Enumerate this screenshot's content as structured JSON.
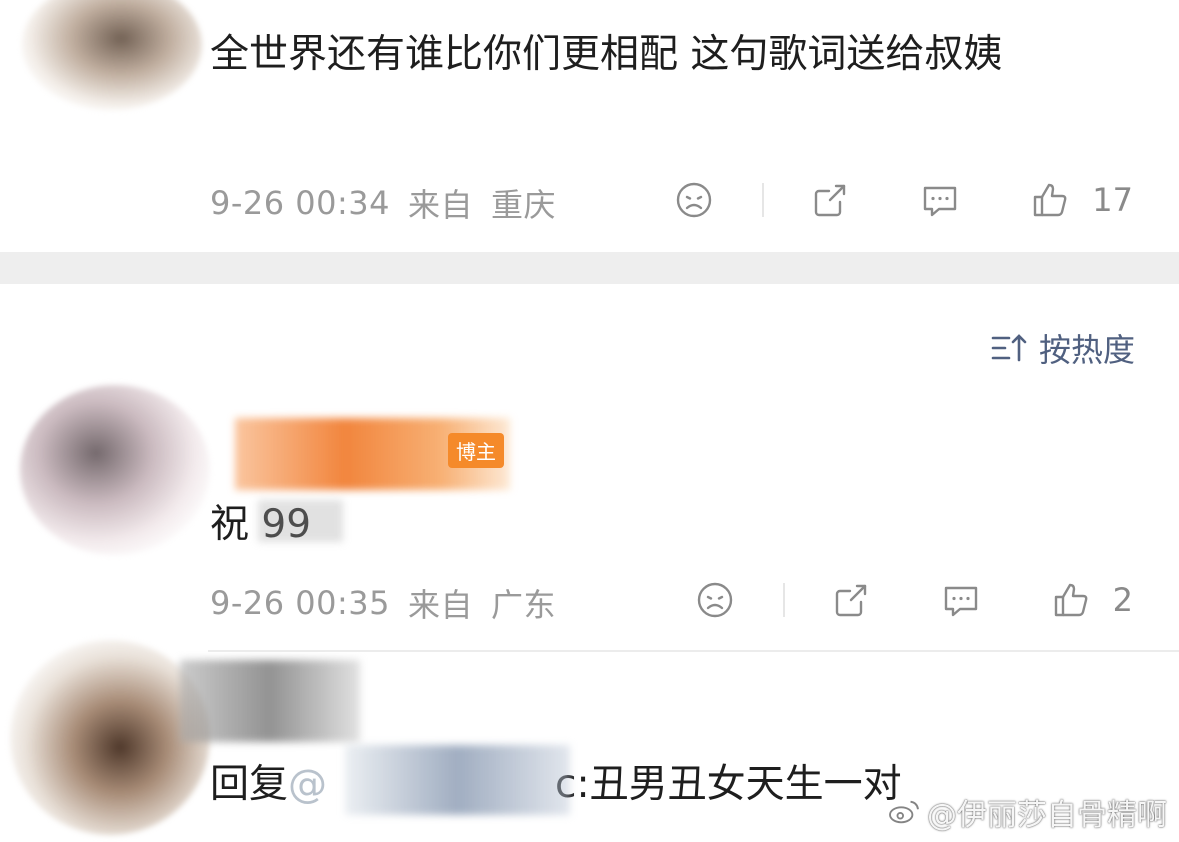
{
  "comments": [
    {
      "text": "全世界还有谁比你们更相配 这句歌词送给叔姨",
      "time": "9-26 00:34",
      "from_label": "来自",
      "location": "重庆",
      "like_count": "17"
    },
    {
      "badge": "博主",
      "text": "祝 99",
      "time": "9-26 00:35",
      "from_label": "来自",
      "location": "广东",
      "like_count": "2"
    },
    {
      "reply_prefix": "回复",
      "reply_at": "@",
      "text": "c:丑男丑女天生一对"
    }
  ],
  "sort": {
    "label": "按热度"
  },
  "watermark": {
    "text": "@伊丽莎自骨精啊"
  }
}
